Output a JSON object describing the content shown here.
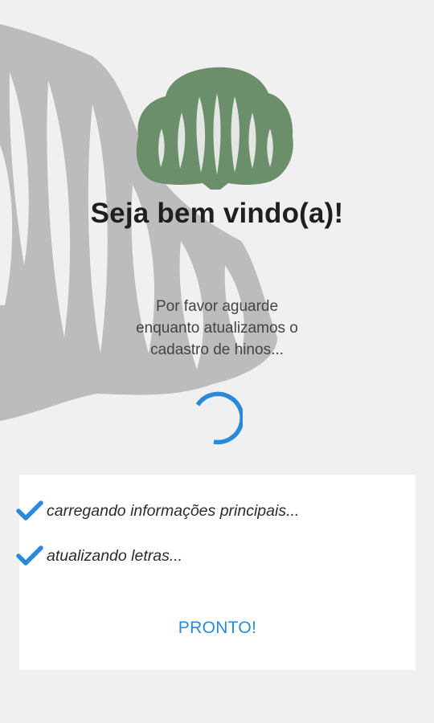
{
  "welcome": {
    "title": "Seja bem vindo(a)!",
    "message_lines": [
      "Por favor aguarde",
      "enquanto atualizamos o",
      "cadastro de hinos..."
    ]
  },
  "progress_panel": {
    "tasks": [
      {
        "label": "carregando informações principais...",
        "status": "check-icon"
      },
      {
        "label": "atualizando letras...",
        "status": "check-icon"
      }
    ],
    "done_label": "PRONTO!"
  },
  "colors": {
    "background": "#f1f0f1",
    "tree_logo": "#6a8f6a",
    "background_tree": "#bcbcbc",
    "accent": "#2b8ad8"
  },
  "icons": {
    "logo": "tree-logo-icon",
    "spinner": "loading-spinner-icon",
    "check": "check-icon"
  }
}
